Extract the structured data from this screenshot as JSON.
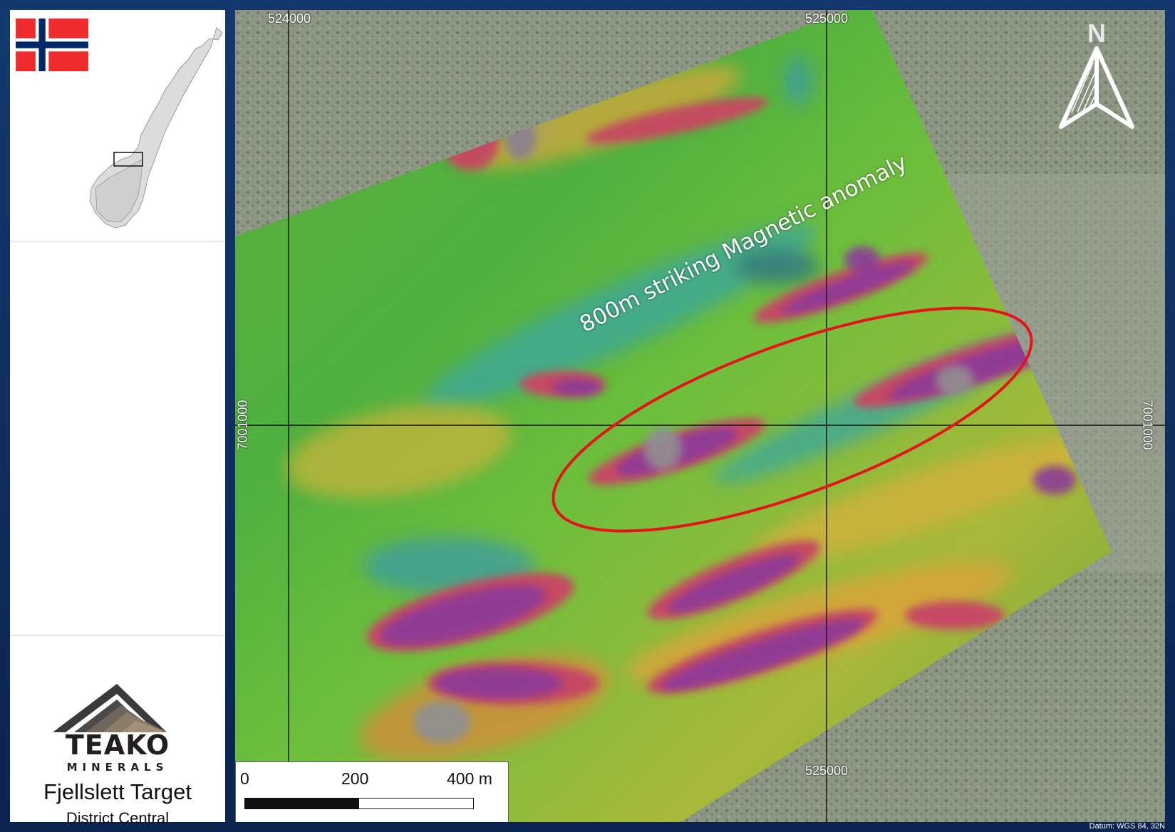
{
  "map": {
    "grid_labels": {
      "top_left_easting": "524000",
      "top_right_easting": "525000",
      "bottom_easting": "525000",
      "left_northing": "7001000",
      "right_northing": "7001000"
    },
    "anomaly_label": "800m striking Magnetic anomaly",
    "north_label": "N",
    "scale": {
      "zero": "0",
      "mid": "200",
      "end": "400 m"
    },
    "datum": "Datum: WGS 84, 32N",
    "colors": {
      "anomaly_ellipse": "#e4141b",
      "grid_line": "#111111",
      "frame": "#0e2a55"
    }
  },
  "sidebar": {
    "flag": "norway-flag-icon",
    "logo_main": "TEAKO",
    "logo_sub": "MINERALS",
    "target_title": "Fjellslett Target",
    "target_subtitle": "District Central"
  }
}
